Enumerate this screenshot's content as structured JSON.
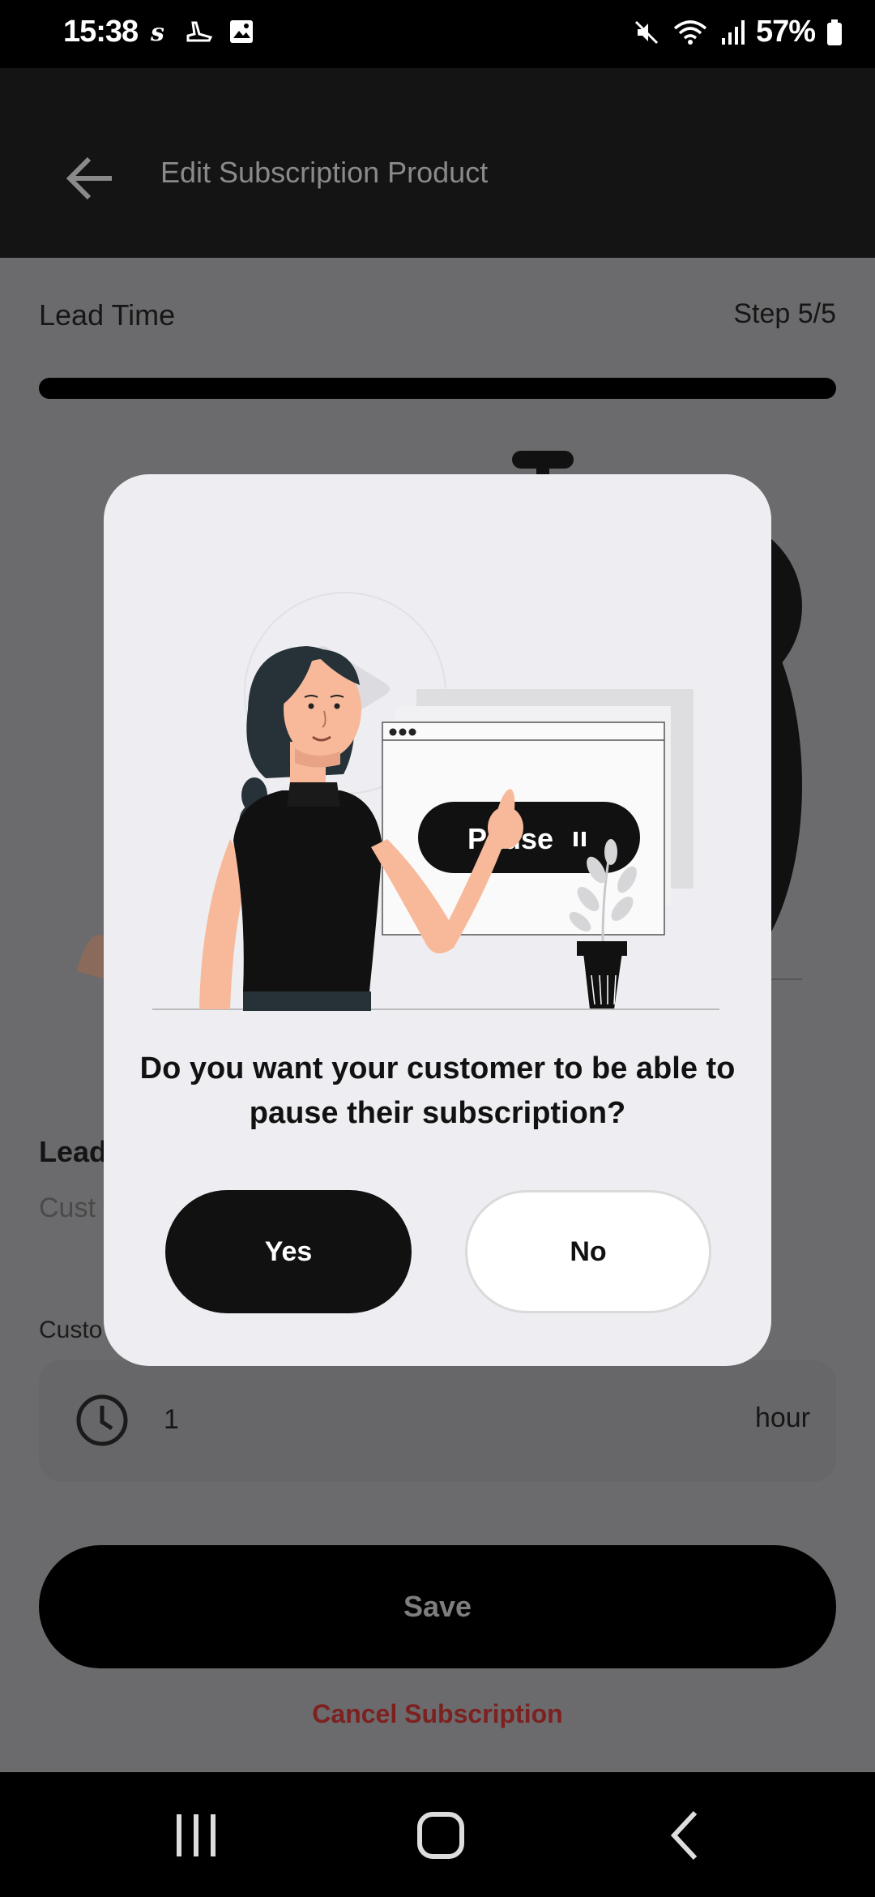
{
  "status_bar": {
    "time": "15:38",
    "battery": "57%",
    "left_icons": [
      "shazam-icon",
      "shoe-icon",
      "image-icon"
    ],
    "right_icons": [
      "mute-icon",
      "wifi-icon",
      "signal-icon",
      "battery-icon"
    ]
  },
  "app_bar": {
    "title": "Edit Subscription Product",
    "back_icon": "arrow-left-icon"
  },
  "step": {
    "title": "Lead Time",
    "count": "Step 5/5",
    "progress": 1.0
  },
  "section": {
    "title": "Lead",
    "description": "Cust fulfil"
  },
  "field": {
    "label": "Custo",
    "value": "1",
    "unit": "hour",
    "icon": "clock-icon"
  },
  "actions": {
    "save_label": "Save",
    "cancel_label": "Cancel Subscription"
  },
  "dialog": {
    "question": "Do you want your customer to be able to pause their subscription?",
    "pause_label": "Pause",
    "yes_label": "Yes",
    "no_label": "No"
  },
  "nav": {
    "recents_icon": "recents-icon",
    "home_icon": "home-icon",
    "back_icon": "back-icon"
  },
  "colors": {
    "scrim": "#6b6b6d",
    "dialog_bg": "#eeeef2",
    "primary": "#111111",
    "danger": "#7d2020",
    "skin": "#f7b99a"
  }
}
